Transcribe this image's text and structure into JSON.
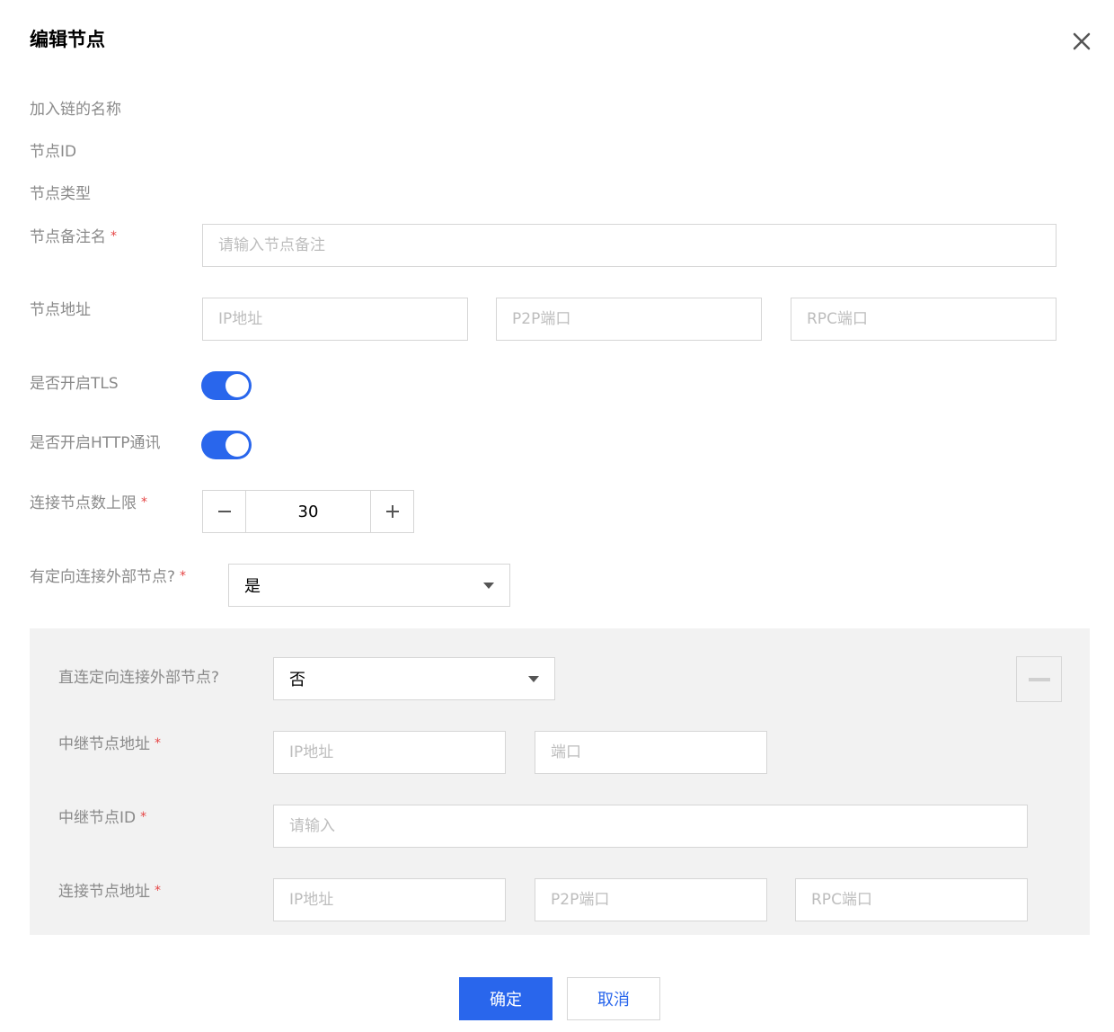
{
  "dialog": {
    "title": "编辑节点"
  },
  "form": {
    "chain_name_label": "加入链的名称",
    "node_id_label": "节点ID",
    "node_type_label": "节点类型",
    "remark_label": "节点备注名",
    "remark_placeholder": "请输入节点备注",
    "address_label": "节点地址",
    "ip_placeholder": "IP地址",
    "p2p_placeholder": "P2P端口",
    "rpc_placeholder": "RPC端口",
    "tls_label": "是否开启TLS",
    "tls_enabled": true,
    "http_label": "是否开启HTTP通讯",
    "http_enabled": true,
    "max_conn_label": "连接节点数上限",
    "max_conn_value": "30",
    "directed_label": "有定向连接外部节点?",
    "directed_value": "是",
    "required_mark": "*"
  },
  "external": {
    "direct_label": "直连定向连接外部节点?",
    "direct_value": "否",
    "relay_addr_label": "中继节点地址",
    "relay_ip_placeholder": "IP地址",
    "relay_port_placeholder": "端口",
    "relay_id_label": "中继节点ID",
    "relay_id_placeholder": "请输入",
    "conn_addr_label": "连接节点地址",
    "conn_ip_placeholder": "IP地址",
    "conn_p2p_placeholder": "P2P端口",
    "conn_rpc_placeholder": "RPC端口"
  },
  "footer": {
    "confirm_label": "确定",
    "cancel_label": "取消"
  },
  "colors": {
    "primary": "#2966ec",
    "required": "#e54545",
    "panel_bg": "#f2f2f2"
  }
}
